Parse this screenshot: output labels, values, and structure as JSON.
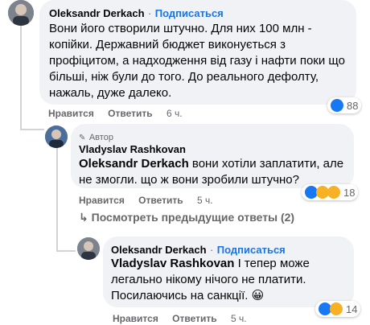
{
  "comments": [
    {
      "author": "Oleksandr Derkach",
      "subscribe": "Подписаться",
      "text": "Вони його створили штучно. Для них 100 млн - копійки. Державний бюджет виконується з профіцитом, а надходження від газу і нафти поки що більші, ніж були до того. До реального дефолту, нажаль, дуже далеко.",
      "like_label": "Нравится",
      "reply_label": "Ответить",
      "time": "6 ч.",
      "reaction_count": "88"
    },
    {
      "badge": "Автор",
      "author": "Vladyslav Rashkovan",
      "mention": "Oleksandr Derkach",
      "text": " вони хотіли заплатити, але не змогли. що ж вони зробили штучно?",
      "like_label": "Нравится",
      "reply_label": "Ответить",
      "time": "5 ч.",
      "reaction_count": "18"
    },
    {
      "author": "Oleksandr Derkach",
      "subscribe": "Подписаться",
      "mention": "Vladyslav Rashkovan",
      "text": " І тепер може легально нікому нічого не платити. Посилаючись на санкції. 😀",
      "like_label": "Нравится",
      "reply_label": "Ответить",
      "time": "5 ч.",
      "reaction_count": "14"
    }
  ],
  "previous_replies": "Посмотреть предыдущие ответы (2)",
  "colors": {
    "bubble": "#f0f2f5",
    "link": "#1b74e4",
    "meta": "#65676b"
  }
}
